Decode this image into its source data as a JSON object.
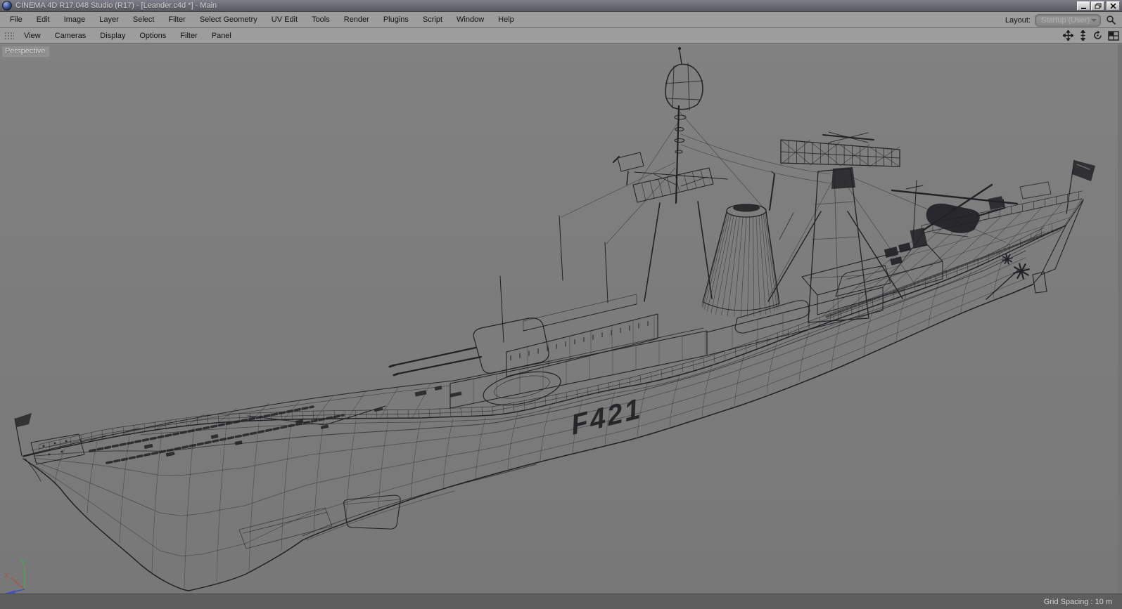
{
  "window": {
    "title": "CINEMA 4D R17.048 Studio (R17) - [Leander.c4d *] - Main"
  },
  "menu_bar": {
    "items": [
      "File",
      "Edit",
      "Image",
      "Layer",
      "Select",
      "Filter",
      "Select Geometry",
      "UV Edit",
      "Tools",
      "Render",
      "Plugins",
      "Script",
      "Window",
      "Help"
    ]
  },
  "layout_selector": {
    "label": "Layout:",
    "value": "Startup (User)"
  },
  "viewport_bar": {
    "items": [
      "View",
      "Cameras",
      "Display",
      "Options",
      "Filter",
      "Panel"
    ]
  },
  "viewport": {
    "camera_label": "Perspective",
    "hull_number": "F421",
    "axis_labels": {
      "x": "X",
      "y": "Y"
    }
  },
  "status_bar": {
    "grid_spacing_label": "Grid Spacing : 10 m"
  },
  "colors": {
    "viewport_bg": "#7d7d7d",
    "toolbar_bg": "#9d9d9d",
    "titlebar_top": "#7e7e88",
    "titlebar_bottom": "#595961",
    "statusbar_bg": "#5e5e5e",
    "wireframe": "#222226",
    "axis_x": "#b9493d",
    "axis_y": "#49a94f",
    "axis_z": "#4053c0"
  }
}
